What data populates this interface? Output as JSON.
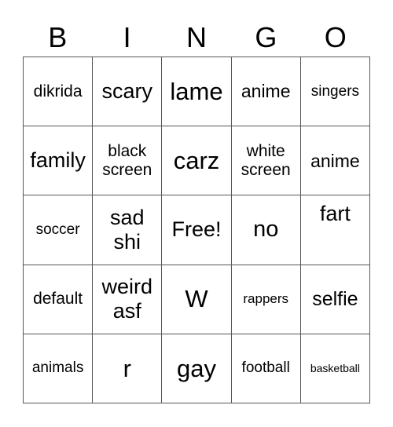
{
  "header": {
    "letters": [
      "B",
      "I",
      "N",
      "G",
      "O"
    ]
  },
  "cells": [
    [
      "dikrida",
      "scary",
      "lame",
      "anime",
      "singers"
    ],
    [
      "family",
      "black screen",
      "carz",
      "white screen",
      "anime"
    ],
    [
      "soccer",
      "sad shi",
      "Free!",
      "no",
      "fart"
    ],
    [
      "default",
      "weird asf",
      "W",
      "rappers",
      "selfie"
    ],
    [
      "animals",
      "r",
      "gay",
      "football",
      "basketball"
    ]
  ]
}
